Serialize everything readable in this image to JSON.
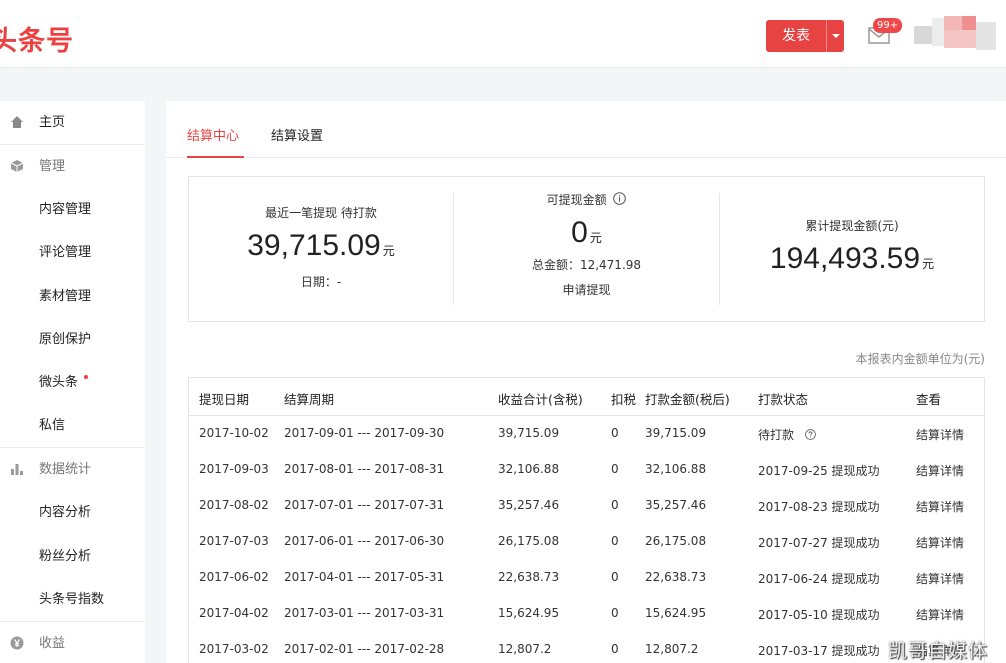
{
  "header": {
    "logo": "头条号",
    "publish_label": "发表",
    "mail_badge": "99+"
  },
  "sidebar": {
    "items": [
      {
        "label": "主页",
        "type": "item",
        "icon": "home-icon"
      },
      {
        "label": "管理",
        "type": "group",
        "icon": "cube-icon"
      },
      {
        "label": "内容管理",
        "type": "sub"
      },
      {
        "label": "评论管理",
        "type": "sub"
      },
      {
        "label": "素材管理",
        "type": "sub"
      },
      {
        "label": "原创保护",
        "type": "sub"
      },
      {
        "label": "微头条",
        "type": "sub"
      },
      {
        "label": "私信",
        "type": "sub"
      },
      {
        "label": "数据统计",
        "type": "group",
        "icon": "bar-chart-icon"
      },
      {
        "label": "内容分析",
        "type": "sub"
      },
      {
        "label": "粉丝分析",
        "type": "sub"
      },
      {
        "label": "头条号指数",
        "type": "sub"
      },
      {
        "label": "收益",
        "type": "group",
        "icon": "yen-icon"
      }
    ]
  },
  "tabs": [
    {
      "label": "结算中心",
      "active": true
    },
    {
      "label": "结算设置",
      "active": false
    }
  ],
  "summary": {
    "last_withdraw": {
      "caption": "最近一笔提现 待打款",
      "amount": "39,715.09",
      "unit": "元",
      "date_label": "日期：-"
    },
    "available": {
      "caption": "可提现金额",
      "amount": "0",
      "unit": "元",
      "total_label": "总金额：12,471.98",
      "apply_link": "申请提现"
    },
    "cumulative": {
      "caption": "累计提现金额(元)",
      "amount": "194,493.59",
      "unit": "元"
    }
  },
  "unit_note": "本报表内金额单位为(元)",
  "table": {
    "headers": [
      "提现日期",
      "结算周期",
      "收益合计(含税)",
      "扣税",
      "打款金额(税后)",
      "打款状态",
      "查看"
    ],
    "rows": [
      {
        "date": "2017-10-02",
        "period": "2017-09-01 --- 2017-09-30",
        "gross": "39,715.09",
        "tax": "0",
        "net": "39,715.09",
        "status": "待打款",
        "detail": "结算详情"
      },
      {
        "date": "2017-09-03",
        "period": "2017-08-01 --- 2017-08-31",
        "gross": "32,106.88",
        "tax": "0",
        "net": "32,106.88",
        "status": "2017-09-25 提现成功",
        "detail": "结算详情"
      },
      {
        "date": "2017-08-02",
        "period": "2017-07-01 --- 2017-07-31",
        "gross": "35,257.46",
        "tax": "0",
        "net": "35,257.46",
        "status": "2017-08-23 提现成功",
        "detail": "结算详情"
      },
      {
        "date": "2017-07-03",
        "period": "2017-06-01 --- 2017-06-30",
        "gross": "26,175.08",
        "tax": "0",
        "net": "26,175.08",
        "status": "2017-07-27 提现成功",
        "detail": "结算详情"
      },
      {
        "date": "2017-06-02",
        "period": "2017-04-01 --- 2017-05-31",
        "gross": "22,638.73",
        "tax": "0",
        "net": "22,638.73",
        "status": "2017-06-24 提现成功",
        "detail": "结算详情"
      },
      {
        "date": "2017-04-02",
        "period": "2017-03-01 --- 2017-03-31",
        "gross": "15,624.95",
        "tax": "0",
        "net": "15,624.95",
        "status": "2017-05-10 提现成功",
        "detail": "结算详情"
      },
      {
        "date": "2017-03-02",
        "period": "2017-02-01 --- 2017-02-28",
        "gross": "12,807.2",
        "tax": "0",
        "net": "12,807.2",
        "status": "2017-03-17 提现成功",
        "detail": "结算详情"
      }
    ]
  },
  "watermark": "凯哥自媒体",
  "colors": {
    "accent": "#e84343",
    "link": "#2d66b6"
  }
}
